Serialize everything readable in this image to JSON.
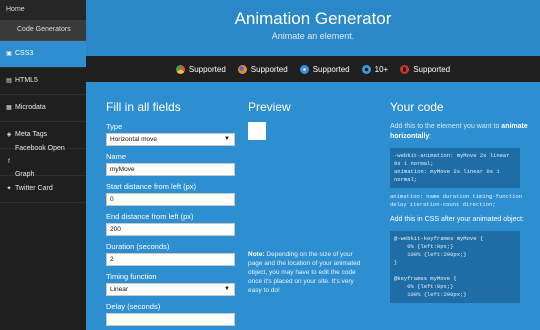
{
  "sidebar": {
    "home": "Home",
    "code_generators": "Code Generators",
    "items": [
      {
        "label": "CSS3",
        "icon": "css3-icon"
      },
      {
        "label": "HTML5",
        "icon": "html5-icon"
      },
      {
        "label": "Microdata",
        "icon": "microdata-icon"
      },
      {
        "label": "Meta Tags",
        "icon": "tag-icon"
      },
      {
        "label": "Facebook Open Graph",
        "icon": "facebook-icon"
      },
      {
        "label": "Twitter Card",
        "icon": "twitter-icon"
      }
    ]
  },
  "header": {
    "title": "Animation Generator",
    "subtitle": "Animate an element."
  },
  "support": [
    {
      "name": "chrome-icon",
      "label": "Supported",
      "color": "#e84c3d"
    },
    {
      "name": "firefox-icon",
      "label": "Supported",
      "color": "#f08a24"
    },
    {
      "name": "safari-icon",
      "label": "Supported",
      "color": "#3b8fd8"
    },
    {
      "name": "ie-icon",
      "label": "10+",
      "color": "#3a9be0"
    },
    {
      "name": "opera-icon",
      "label": "Supported",
      "color": "#d0312d"
    }
  ],
  "form": {
    "heading": "Fill in all fields",
    "type_label": "Type",
    "type_value": "Horizontal move",
    "name_label": "Name",
    "name_value": "myMove",
    "start_label": "Start distance from left (px)",
    "start_value": "0",
    "end_label": "End distance from left (px)",
    "end_value": "200",
    "duration_label": "Duration (seconds)",
    "duration_value": "2",
    "timing_label": "Timing function",
    "timing_value": "Linear",
    "delay_label": "Delay (seconds)"
  },
  "preview": {
    "heading": "Preview",
    "note_bold": "Note:",
    "note_text": " Depending on the size of your page and the location of your animated object, you may have to edit the code once it's placed on your site. It's very easy to do!"
  },
  "code": {
    "heading": "Your code",
    "intro": "Add this to the element you want to ",
    "intro_bold": "animate horizontally",
    "intro_end": ":",
    "block1": "-webkit-animation: myMove 2s linear 0s 1 normal;\nanimation: myMove 2s linear 0s 1 normal;",
    "syntax": "animation: name duration timing-function delay iteration-count direction;",
    "css_heading": "Add this in CSS after your animated object:",
    "block2": "@-webkit-keyframes myMove {\n    0% {left:0px;}\n    100% {left:200px;}\n}\n\n@keyframes myMove {\n    0% {left:0px;}\n    100% {left:200px;}"
  }
}
